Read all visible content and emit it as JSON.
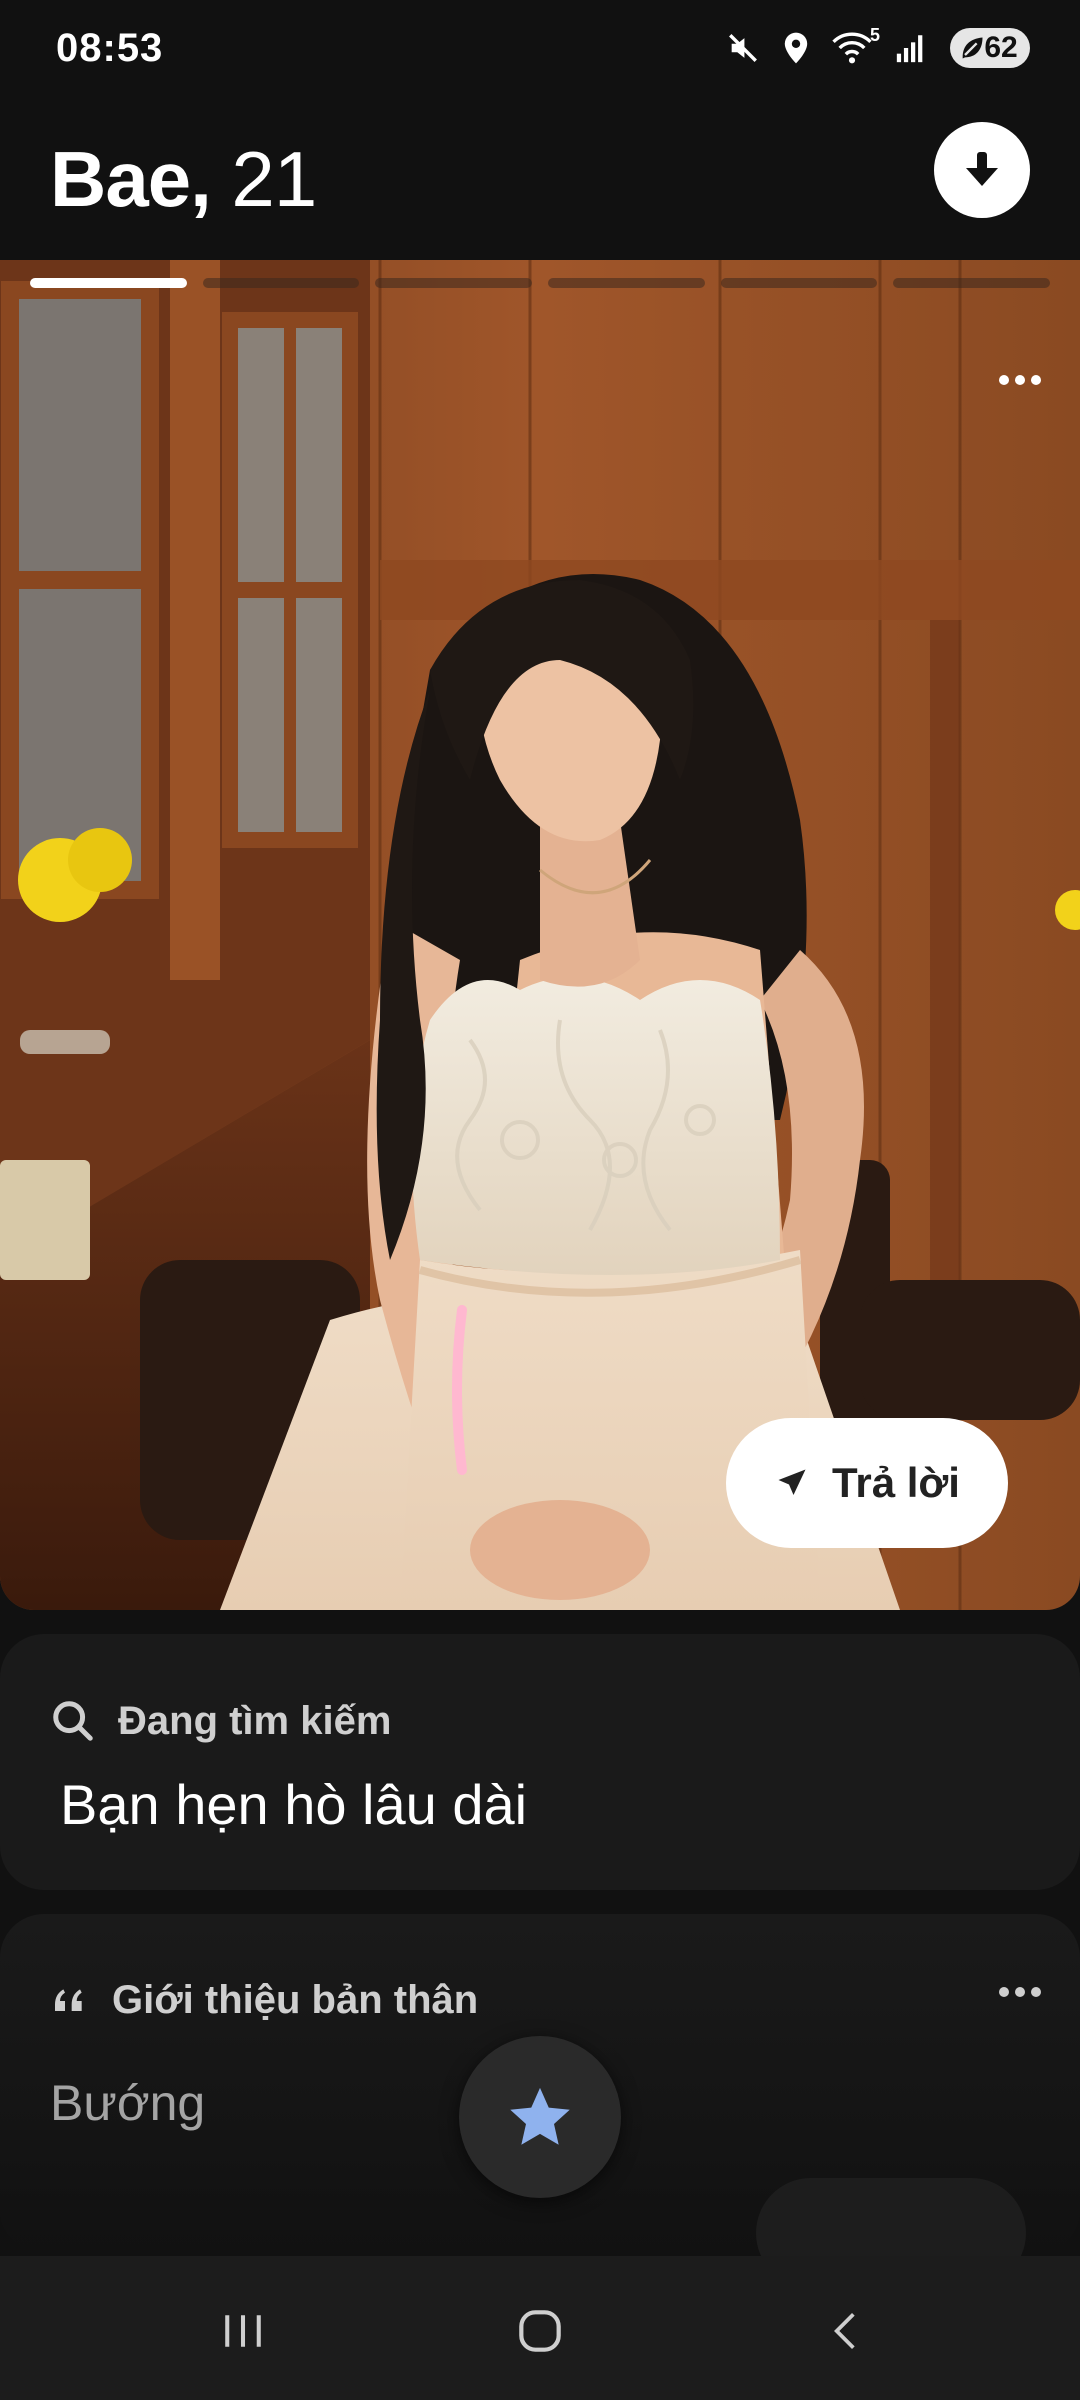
{
  "status_bar": {
    "time": "08:53",
    "icons": [
      "mute-icon",
      "location-icon",
      "wifi-icon",
      "signal-icon"
    ],
    "wifi_badge": "5",
    "battery_level": "62"
  },
  "header": {
    "name": "Bae,",
    "age": " 21",
    "download_icon": "download-icon"
  },
  "photo": {
    "segments_total": 6,
    "active_segment": 1,
    "reply_label": "Trả lời"
  },
  "looking_for": {
    "title": "Đang tìm kiếm",
    "value": "Bạn hẹn hò lâu dài"
  },
  "intro": {
    "title": "Giới thiệu bản thân",
    "text": "Bướng"
  },
  "colors": {
    "background": "#111111",
    "card": "#1a1a1a",
    "star": "#8fb2ee"
  }
}
